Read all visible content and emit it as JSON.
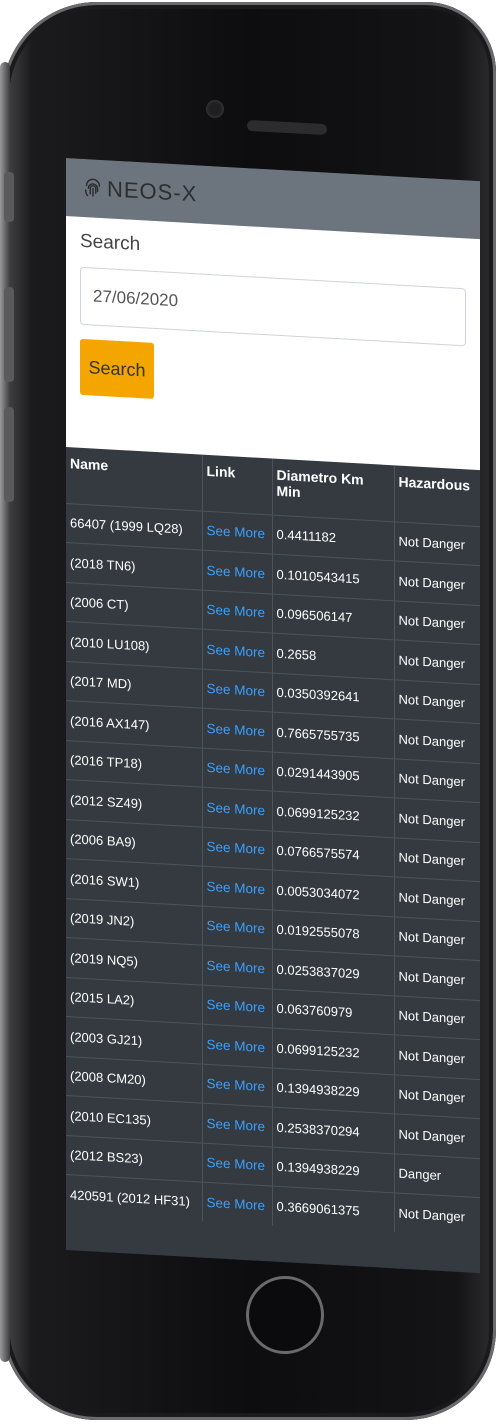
{
  "app": {
    "brand": "NEOS-X",
    "brand_icon": "fingerprint-icon",
    "colors": {
      "navbar": "#6c757d",
      "button": "#f5a500",
      "table_bg": "#343a40",
      "link": "#3aa0ff"
    }
  },
  "search": {
    "label": "Search",
    "value": "27/06/2020",
    "button_label": "Search"
  },
  "table": {
    "headers": [
      "Name",
      "Link",
      "Diametro Km Min",
      "Hazardous"
    ],
    "rows": [
      {
        "name": "66407 (1999 LQ28)",
        "link": "See More",
        "diameter": "0.4411182",
        "hazardous": "Not Danger"
      },
      {
        "name": "(2018 TN6)",
        "link": "See More",
        "diameter": "0.1010543415",
        "hazardous": "Not Danger"
      },
      {
        "name": "(2006 CT)",
        "link": "See More",
        "diameter": "0.096506147",
        "hazardous": "Not Danger"
      },
      {
        "name": "(2010 LU108)",
        "link": "See More",
        "diameter": "0.2658",
        "hazardous": "Not Danger"
      },
      {
        "name": "(2017 MD)",
        "link": "See More",
        "diameter": "0.0350392641",
        "hazardous": "Not Danger"
      },
      {
        "name": "(2016 AX147)",
        "link": "See More",
        "diameter": "0.7665755735",
        "hazardous": "Not Danger"
      },
      {
        "name": "(2016 TP18)",
        "link": "See More",
        "diameter": "0.0291443905",
        "hazardous": "Not Danger"
      },
      {
        "name": "(2012 SZ49)",
        "link": "See More",
        "diameter": "0.0699125232",
        "hazardous": "Not Danger"
      },
      {
        "name": "(2006 BA9)",
        "link": "See More",
        "diameter": "0.0766575574",
        "hazardous": "Not Danger"
      },
      {
        "name": "(2016 SW1)",
        "link": "See More",
        "diameter": "0.0053034072",
        "hazardous": "Not Danger"
      },
      {
        "name": "(2019 JN2)",
        "link": "See More",
        "diameter": "0.0192555078",
        "hazardous": "Not Danger"
      },
      {
        "name": "(2019 NQ5)",
        "link": "See More",
        "diameter": "0.0253837029",
        "hazardous": "Not Danger"
      },
      {
        "name": "(2015 LA2)",
        "link": "See More",
        "diameter": "0.063760979",
        "hazardous": "Not Danger"
      },
      {
        "name": "(2003 GJ21)",
        "link": "See More",
        "diameter": "0.0699125232",
        "hazardous": "Not Danger"
      },
      {
        "name": "(2008 CM20)",
        "link": "See More",
        "diameter": "0.1394938229",
        "hazardous": "Not Danger"
      },
      {
        "name": "(2010 EC135)",
        "link": "See More",
        "diameter": "0.2538370294",
        "hazardous": "Not Danger"
      },
      {
        "name": "(2012 BS23)",
        "link": "See More",
        "diameter": "0.1394938229",
        "hazardous": "Danger"
      },
      {
        "name": "420591 (2012 HF31)",
        "link": "See More",
        "diameter": "0.3669061375",
        "hazardous": "Not Danger"
      }
    ]
  }
}
